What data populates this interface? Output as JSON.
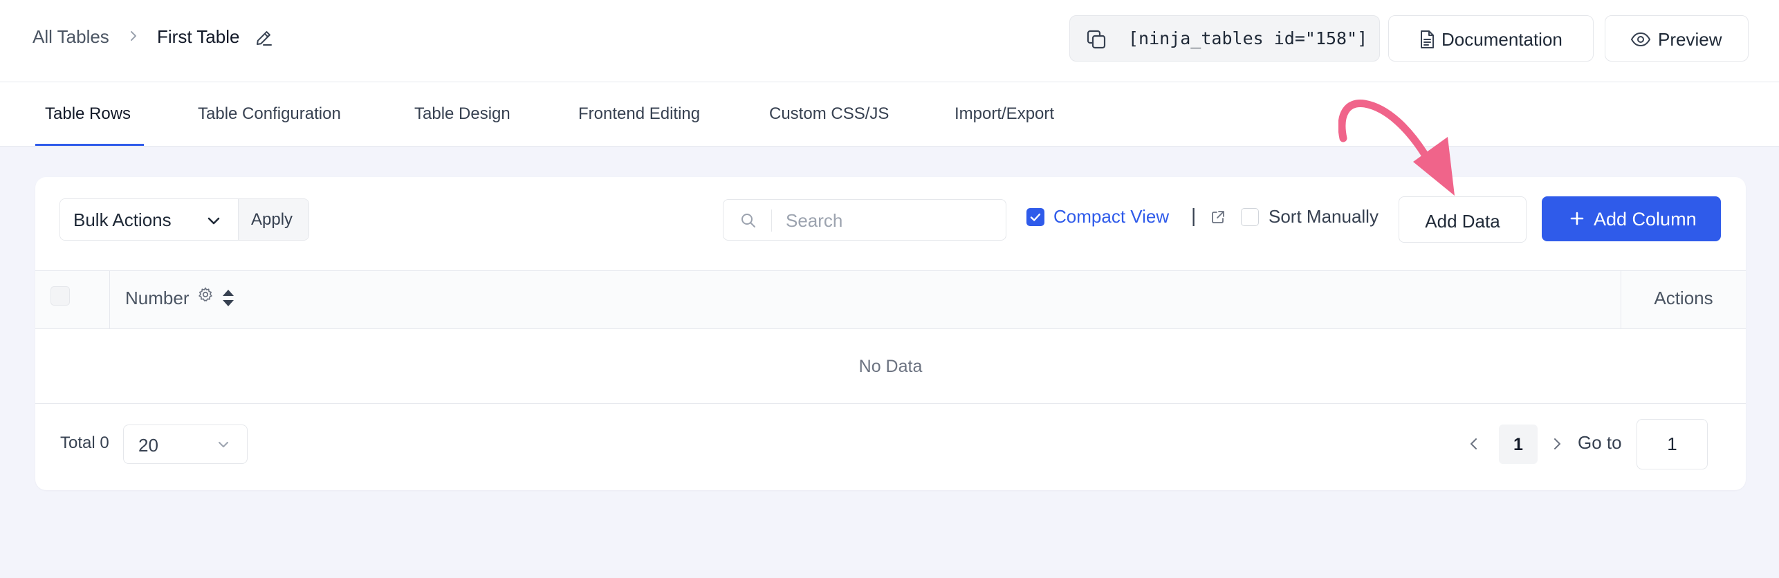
{
  "breadcrumb": {
    "root": "All Tables",
    "current": "First Table"
  },
  "header": {
    "shortcode": "[ninja_tables id=\"158\"]",
    "documentation_label": "Documentation",
    "preview_label": "Preview"
  },
  "tabs": [
    {
      "label": "Table Rows",
      "active": true
    },
    {
      "label": "Table Configuration",
      "active": false
    },
    {
      "label": "Table Design",
      "active": false
    },
    {
      "label": "Frontend Editing",
      "active": false
    },
    {
      "label": "Custom CSS/JS",
      "active": false
    },
    {
      "label": "Import/Export",
      "active": false
    }
  ],
  "toolbar": {
    "bulk_actions": "Bulk Actions",
    "apply": "Apply",
    "search_placeholder": "Search",
    "compact_view": {
      "label": "Compact View",
      "checked": true
    },
    "sort_manually": {
      "label": "Sort Manually",
      "checked": false
    },
    "add_data": "Add Data",
    "add_column": "Add Column"
  },
  "table": {
    "columns": [
      "Number",
      "Actions"
    ],
    "empty_text": "No Data"
  },
  "footer": {
    "total": "Total 0",
    "page_size": "20",
    "current_page": "1",
    "goto_label": "Go to",
    "goto_value": "1"
  },
  "colors": {
    "accent": "#2f5bea",
    "background": "#f3f4fb",
    "annotation_arrow": "#f0648a"
  },
  "icons": [
    "chevron-right-icon",
    "pencil-icon",
    "copy-icon",
    "document-icon",
    "eye-icon",
    "chevron-down-icon",
    "search-icon",
    "external-link-icon",
    "gear-icon",
    "sort-icon",
    "plus-icon",
    "chevron-left-icon"
  ]
}
